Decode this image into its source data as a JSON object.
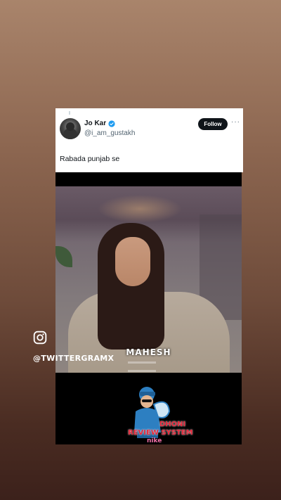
{
  "tweet": {
    "display_name": "Jo Kar",
    "handle": "@i_am_gustakh",
    "follow_label": "Follow",
    "more_label": "···",
    "text": "Rabada punjab se",
    "verified_color": "#1d9bf0"
  },
  "video": {
    "caption_name": "MAHESH"
  },
  "watermark": {
    "brand_line1": "DHONI",
    "brand_line2": "REVIEW SYSTEM",
    "brand_line3": "nike"
  },
  "story": {
    "instagram_handle": "@TWITTERGRAMX",
    "icon": "instagram-icon"
  }
}
